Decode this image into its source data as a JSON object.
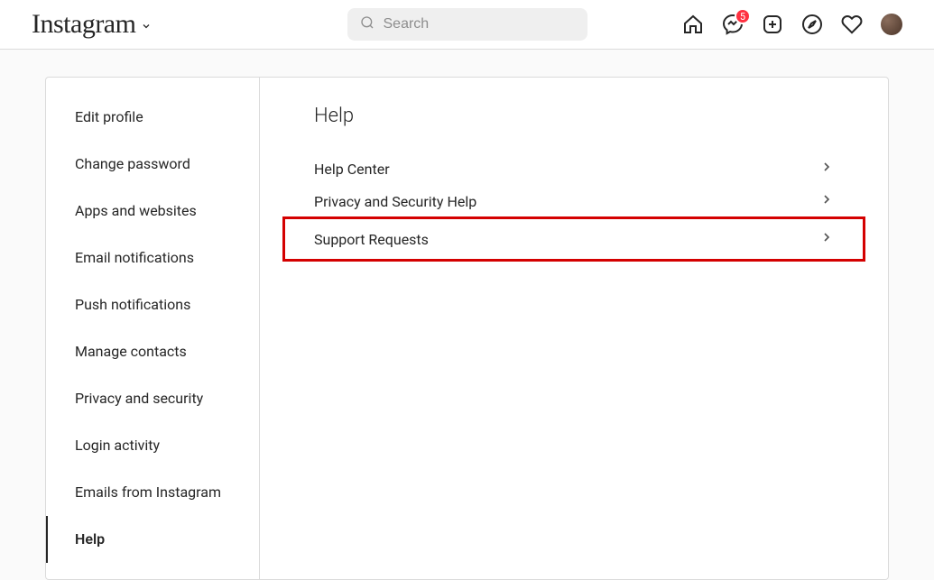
{
  "logo": "Instagram",
  "search": {
    "placeholder": "Search"
  },
  "badge_count": "5",
  "sidebar": {
    "items": [
      {
        "label": "Edit profile",
        "active": false
      },
      {
        "label": "Change password",
        "active": false
      },
      {
        "label": "Apps and websites",
        "active": false
      },
      {
        "label": "Email notifications",
        "active": false
      },
      {
        "label": "Push notifications",
        "active": false
      },
      {
        "label": "Manage contacts",
        "active": false
      },
      {
        "label": "Privacy and security",
        "active": false
      },
      {
        "label": "Login activity",
        "active": false
      },
      {
        "label": "Emails from Instagram",
        "active": false
      },
      {
        "label": "Help",
        "active": true
      }
    ]
  },
  "content": {
    "title": "Help",
    "items": [
      {
        "label": "Help Center",
        "highlighted": false
      },
      {
        "label": "Privacy and Security Help",
        "highlighted": false
      },
      {
        "label": "Support Requests",
        "highlighted": true
      }
    ]
  }
}
